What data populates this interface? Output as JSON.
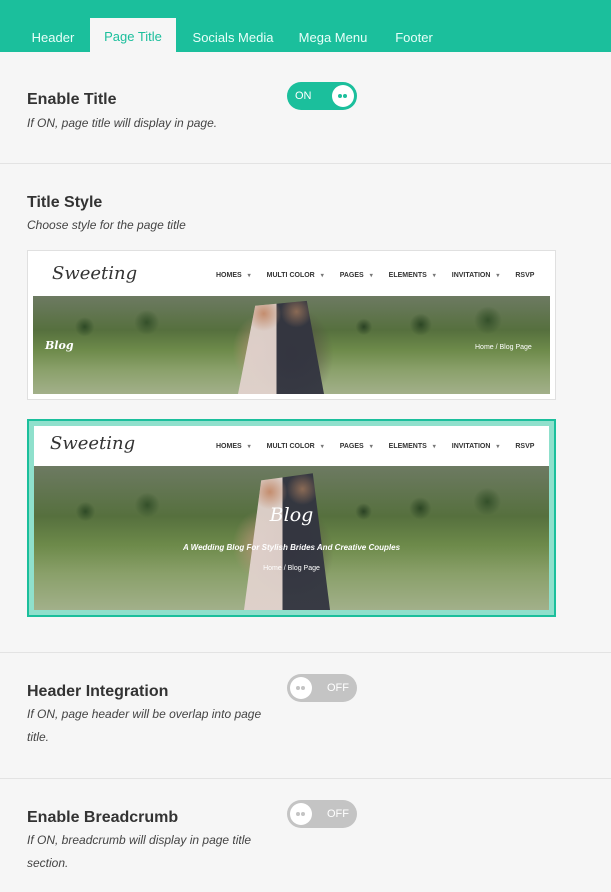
{
  "tabs": [
    {
      "label": "Header",
      "active": false
    },
    {
      "label": "Page Title",
      "active": true
    },
    {
      "label": "Socials Media",
      "active": false
    },
    {
      "label": "Mega Menu",
      "active": false
    },
    {
      "label": "Footer",
      "active": false
    }
  ],
  "sections": {
    "enable_title": {
      "title": "Enable Title",
      "desc": "If ON, page title will display in page.",
      "toggle": "ON"
    },
    "title_style": {
      "title": "Title Style",
      "desc": "Choose style for the page title"
    },
    "header_integration": {
      "title": "Header Integration",
      "desc_line1": "If ON, page header will be overlap into page",
      "desc_line2": "title.",
      "toggle": "OFF"
    },
    "enable_breadcrumb": {
      "title": "Enable Breadcrumb",
      "desc_line1": "If ON, breadcrumb will display in page title",
      "desc_line2": "section.",
      "toggle": "OFF"
    }
  },
  "preview": {
    "logo": "Sweeting",
    "nav": [
      "HOMES",
      "MULTI COLOR",
      "PAGES",
      "ELEMENTS",
      "INVITATION",
      "RSVP"
    ],
    "style1": {
      "blog": "Blog",
      "crumb": "Home / Blog Page",
      "selected": false
    },
    "style2": {
      "blog": "Blog",
      "tagline": "A Wedding Blog For Stylish Brides And Creative Couples",
      "crumb": "Home / Blog Page",
      "selected": true
    }
  },
  "colors": {
    "accent": "#1bbf9c",
    "toggle_off": "#c4c4c4"
  }
}
